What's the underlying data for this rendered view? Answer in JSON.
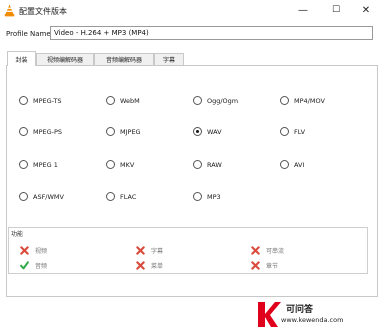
{
  "window": {
    "title": "配置文件版本",
    "controls": {
      "minimize": "—",
      "maximize": "☐",
      "close": "✕"
    }
  },
  "profile": {
    "label": "Profile Name",
    "value": "Video - H.264 + MP3 (MP4)"
  },
  "tabs": [
    {
      "label": "封装",
      "active": true
    },
    {
      "label": "视频编解码器",
      "active": false
    },
    {
      "label": "音频编解码器",
      "active": false
    },
    {
      "label": "字幕",
      "active": false
    }
  ],
  "encapsulation": {
    "options": [
      {
        "label": "MPEG-TS",
        "checked": false
      },
      {
        "label": "WebM",
        "checked": false
      },
      {
        "label": "Ogg/Ogm",
        "checked": false
      },
      {
        "label": "MP4/MOV",
        "checked": false
      },
      {
        "label": "MPEG-PS",
        "checked": false
      },
      {
        "label": "MJPEG",
        "checked": false
      },
      {
        "label": "WAV",
        "checked": true
      },
      {
        "label": "FLV",
        "checked": false
      },
      {
        "label": "MPEG 1",
        "checked": false
      },
      {
        "label": "MKV",
        "checked": false
      },
      {
        "label": "RAW",
        "checked": false
      },
      {
        "label": "AVI",
        "checked": false
      },
      {
        "label": "ASF/WMV",
        "checked": false
      },
      {
        "label": "FLAC",
        "checked": false
      },
      {
        "label": "MP3",
        "checked": false
      }
    ]
  },
  "features": {
    "title": "功能",
    "items": [
      {
        "label": "视频",
        "supported": false,
        "icon": "cross-icon"
      },
      {
        "label": "字幕",
        "supported": false,
        "icon": "cross-icon"
      },
      {
        "label": "可串流",
        "supported": false,
        "icon": "cross-icon"
      },
      {
        "label": "音频",
        "supported": true,
        "icon": "check-icon"
      },
      {
        "label": "菜单",
        "supported": false,
        "icon": "cross-icon"
      },
      {
        "label": "章节",
        "supported": false,
        "icon": "cross-icon"
      }
    ]
  },
  "watermark": {
    "line1": "可问答",
    "line2": "www.kewenda.com"
  },
  "colors": {
    "cross": "#d94c3d",
    "check": "#2fa84a",
    "watermark_k": "#e0001b"
  }
}
